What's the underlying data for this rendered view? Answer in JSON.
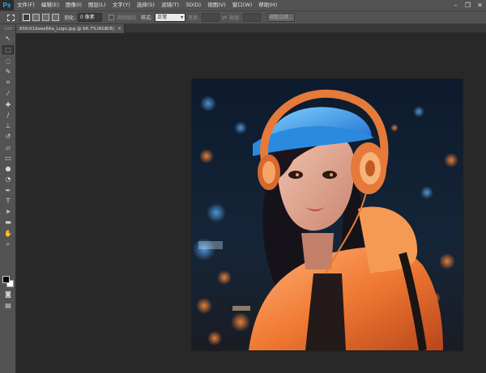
{
  "app": {
    "logo_text": "Ps"
  },
  "menu": {
    "items": [
      "文件(F)",
      "编辑(E)",
      "图像(I)",
      "图层(L)",
      "文字(Y)",
      "选择(S)",
      "滤镜(T)",
      "3D(D)",
      "视图(V)",
      "窗口(W)",
      "帮助(H)"
    ]
  },
  "window_controls": {
    "minimize": "–",
    "restore": "❐",
    "close": "✕"
  },
  "options": {
    "feather_label": "羽化:",
    "feather_value": "0 像素",
    "antialias_label": "消除锯齿",
    "style_label": "样式:",
    "style_value": "正常",
    "width_label": "宽度:",
    "swap_glyph": "⇄",
    "height_label": "高度:",
    "refine_edge_label": "调整边缘..."
  },
  "document": {
    "tab_title": "65fc01deee66a_Logo.jpg @ 66.7%(RGB/8)",
    "close_glyph": "×"
  },
  "tools": [
    {
      "name": "move-tool",
      "glyph": "↖"
    },
    {
      "name": "rect-marquee-tool",
      "glyph": "⬚"
    },
    {
      "name": "lasso-tool",
      "glyph": "◌"
    },
    {
      "name": "quick-select-tool",
      "glyph": "✎"
    },
    {
      "name": "crop-tool",
      "glyph": "⌗"
    },
    {
      "name": "eyedropper-tool",
      "glyph": "⁄"
    },
    {
      "name": "healing-brush-tool",
      "glyph": "✚"
    },
    {
      "name": "brush-tool",
      "glyph": "/"
    },
    {
      "name": "clone-stamp-tool",
      "glyph": "⊥"
    },
    {
      "name": "history-brush-tool",
      "glyph": "↺"
    },
    {
      "name": "eraser-tool",
      "glyph": "▱"
    },
    {
      "name": "gradient-tool",
      "glyph": "▭"
    },
    {
      "name": "blur-tool",
      "glyph": "●"
    },
    {
      "name": "dodge-tool",
      "glyph": "◔"
    },
    {
      "name": "pen-tool",
      "glyph": "✒"
    },
    {
      "name": "type-tool",
      "glyph": "T"
    },
    {
      "name": "path-select-tool",
      "glyph": "➤"
    },
    {
      "name": "shape-tool",
      "glyph": "▬"
    },
    {
      "name": "hand-tool",
      "glyph": "✋"
    },
    {
      "name": "zoom-tool",
      "glyph": "⌕"
    },
    {
      "name": "quick-mask-tool",
      "glyph": "◙"
    },
    {
      "name": "screen-mode-tool",
      "glyph": "▤"
    }
  ],
  "colors": {
    "foreground": "#000000",
    "background": "#ffffff",
    "hat": "#2f8fe6",
    "headphones": "#e67a3a",
    "jacket": "#f0823a"
  }
}
